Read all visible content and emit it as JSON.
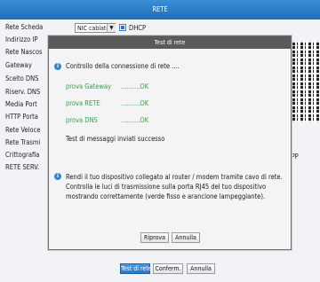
{
  "window": {
    "title": "RETE"
  },
  "form": {
    "labels": [
      "Rete Scheda",
      "Indirizzo IP",
      "Rete Nascos",
      "Gateway",
      "Scelto DNS",
      "Riserv. DNS",
      "Media Port",
      "HTTP Porta",
      "Rete Veloce",
      "Rete Trasmi",
      "Crittografia",
      "RETE SERV."
    ],
    "nic_value": "NIC cablato",
    "dhcp_label": "DHCP",
    "dhcp_checked": true,
    "app_label": "APP"
  },
  "bottom_buttons": {
    "test": "Test di rete",
    "confirm": "Conferm.",
    "cancel": "Annulla"
  },
  "dialog": {
    "title": "Test di rete",
    "checking": "Controllo della connessione di rete ....",
    "tests": [
      {
        "name": "prova Gateway",
        "result": "..........OK"
      },
      {
        "name": "prova RETE",
        "result": "..........OK"
      },
      {
        "name": "prova DNS",
        "result": "..........OK"
      }
    ],
    "message_result": "Test di messaggi inviati successo",
    "advice": "Rendi il tuo dispositivo collegato al router / modem tramite cavo di rete. Controlla le luci di trasmissione sulla porta RJ45 del tuo dispositivo mostrando correttamente (verde fisso e arancione lampeggiante).",
    "retry": "Riprova",
    "cancel": "Annulla"
  },
  "colors": {
    "title_bar": "#2a7dc8",
    "dialog_title": "#5a5a5a",
    "ok_green": "#2aa84a",
    "info_icon": "#2f86d6"
  }
}
